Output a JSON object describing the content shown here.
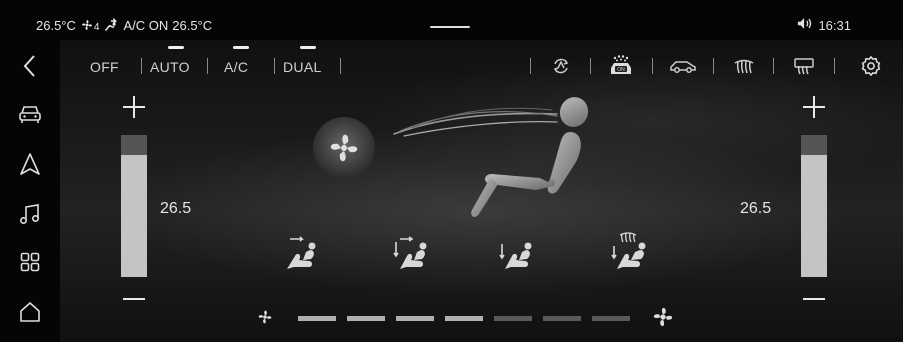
{
  "status_bar": {
    "temp_left": "26.5°C",
    "fan_level": "4",
    "ac_status": "A/C ON",
    "temp_right": "26.5°C",
    "time": "16:31"
  },
  "modes": {
    "off": "OFF",
    "auto": "AUTO",
    "ac": "A/C",
    "dual": "DUAL"
  },
  "climate": {
    "driver_temp": "26.5",
    "passenger_temp": "26.5",
    "driver_temp_level": 0.86,
    "passenger_temp_level": 0.86,
    "fan_speed_level": 4,
    "fan_speed_max": 7
  },
  "airflow_modes": [
    "face",
    "face-feet",
    "feet",
    "feet-defrost"
  ],
  "colors": {
    "accent": "#eeeeee",
    "bar_fill": "#c4c4c4",
    "bar_top": "#555555",
    "fan_on": "#b0b0b0",
    "fan_off": "#5a5a5a"
  },
  "icons": {
    "back": "chevron-left-icon",
    "car": "car-icon",
    "navigation": "navigation-icon",
    "music": "music-icon",
    "apps": "apps-grid-icon",
    "home": "home-icon",
    "volume": "volume-icon",
    "settings": "gear-icon"
  }
}
